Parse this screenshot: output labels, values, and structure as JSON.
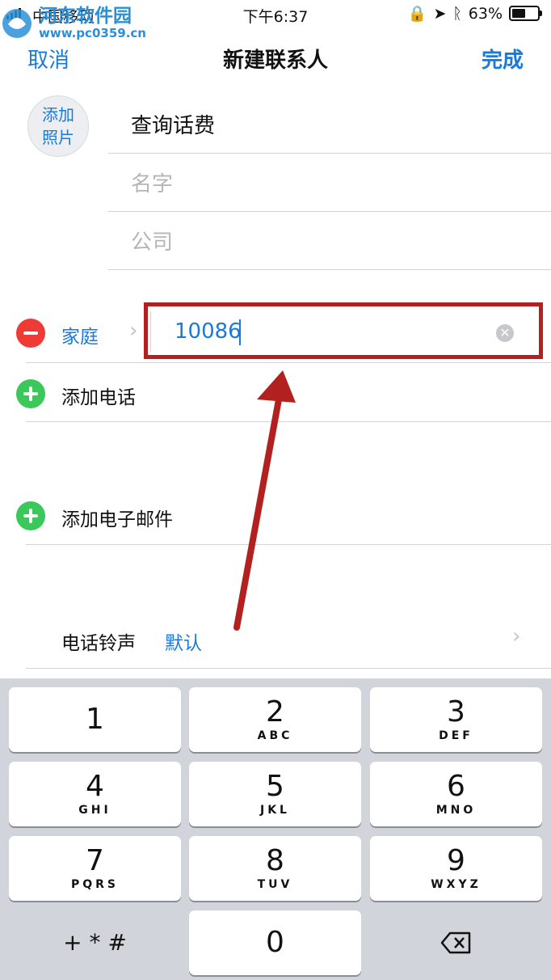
{
  "status_bar": {
    "carrier": "中国移动",
    "time": "下午6:37",
    "battery": "63%",
    "battery_level": 0.63
  },
  "watermark": {
    "name": "河东软件园",
    "url": "www.pc0359.cn"
  },
  "nav": {
    "cancel": "取消",
    "title": "新建联系人",
    "done": "完成"
  },
  "photo": {
    "line1": "添加",
    "line2": "照片"
  },
  "fields": {
    "last_name": "查询话费",
    "first_name_placeholder": "名字",
    "company_placeholder": "公司"
  },
  "phone": {
    "label": "家庭",
    "value": "10086"
  },
  "rows": {
    "add_phone": "添加电话",
    "add_email": "添加电子邮件",
    "ringtone_label": "电话铃声",
    "ringtone_value": "默认"
  },
  "keypad": {
    "keys": [
      {
        "n": "1",
        "l": ""
      },
      {
        "n": "2",
        "l": "ABC"
      },
      {
        "n": "3",
        "l": "DEF"
      },
      {
        "n": "4",
        "l": "GHI"
      },
      {
        "n": "5",
        "l": "JKL"
      },
      {
        "n": "6",
        "l": "MNO"
      },
      {
        "n": "7",
        "l": "PQRS"
      },
      {
        "n": "8",
        "l": "TUV"
      },
      {
        "n": "9",
        "l": "WXYZ"
      },
      {
        "n": "+ * #",
        "l": ""
      },
      {
        "n": "0",
        "l": ""
      },
      {
        "n": "backspace",
        "l": ""
      }
    ]
  },
  "colors": {
    "accent": "#1a7ad9",
    "highlight_box": "#b2201f",
    "delete_red": "#ef3b36",
    "add_green": "#3bc85a"
  }
}
